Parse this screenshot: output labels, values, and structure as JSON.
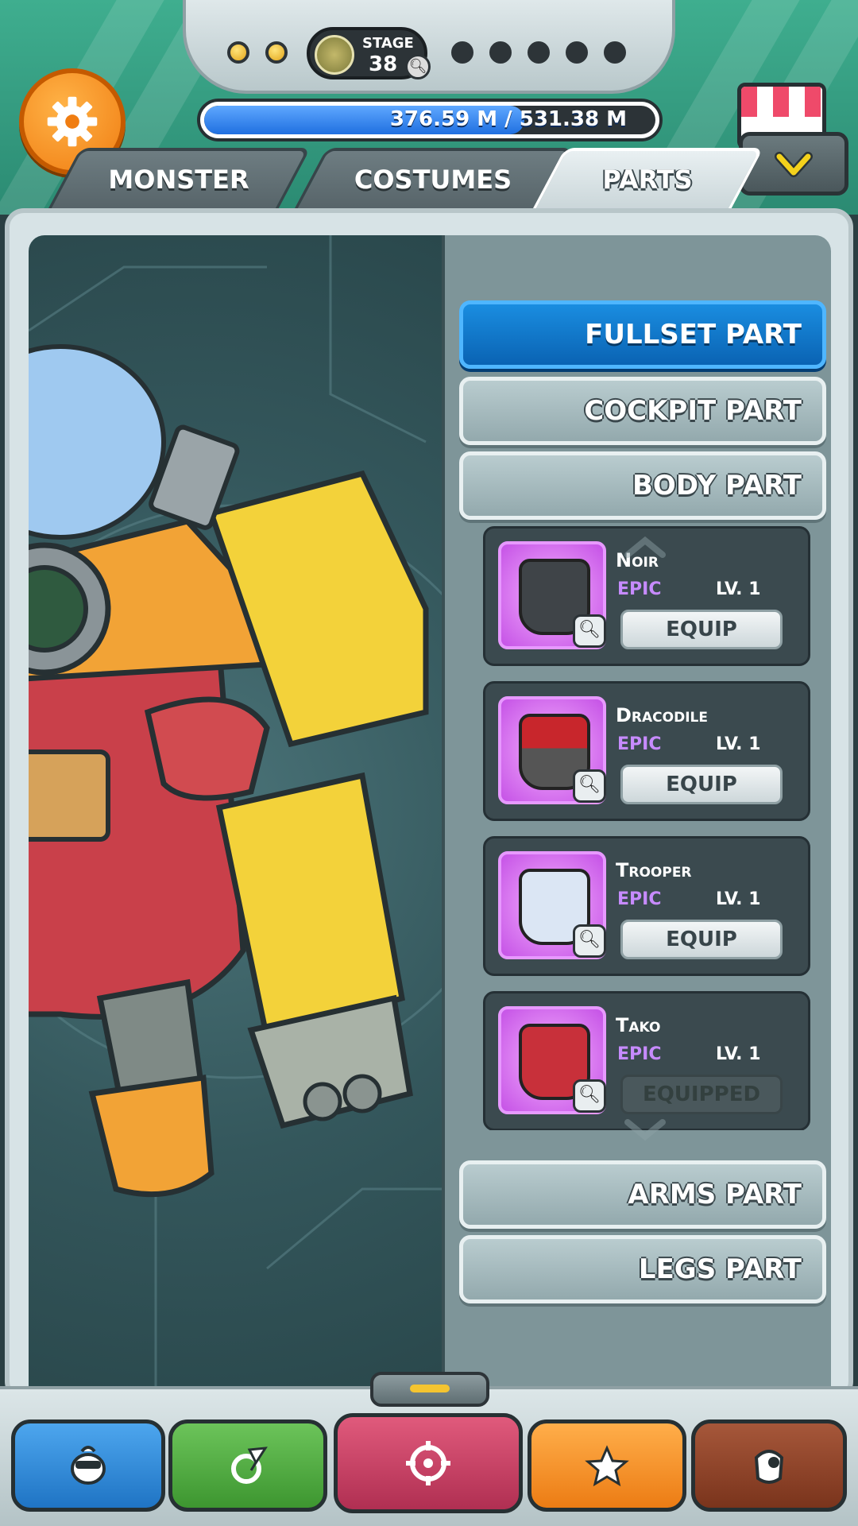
{
  "header": {
    "stage_label": "STAGE",
    "stage_number": "38",
    "progress_dots": {
      "filled": 2,
      "empty": 5
    },
    "hp_current": "376.59 M",
    "hp_max": "531.38 M",
    "hp_separator": "/",
    "hp_fraction": 0.709
  },
  "tabs": [
    {
      "label": "MONSTER",
      "active": false
    },
    {
      "label": "COSTUMES",
      "active": false
    },
    {
      "label": "PARTS",
      "active": true
    }
  ],
  "categories": {
    "fullset": "FULLSET PART",
    "cockpit": "COCKPIT PART",
    "body": "BODY PART",
    "arms": "ARMS PART",
    "legs": "LEGS PART"
  },
  "items": [
    {
      "name": "Noir",
      "rarity": "EPIC",
      "level": "LV. 1",
      "action": "EQUIP",
      "mask_color": "#3f4448",
      "accent": "#e6a020"
    },
    {
      "name": "Dracodile",
      "rarity": "EPIC",
      "level": "LV. 1",
      "action": "EQUIP",
      "mask_color": "#c8262c",
      "accent": "#444"
    },
    {
      "name": "Trooper",
      "rarity": "EPIC",
      "level": "LV. 1",
      "action": "EQUIP",
      "mask_color": "#dbe6f4",
      "accent": "#2c3337"
    },
    {
      "name": "Tako",
      "rarity": "EPIC",
      "level": "LV. 1",
      "action": "EQUIPPED",
      "mask_color": "#c8303a",
      "accent": "#e8c35a"
    }
  ],
  "bottom_nav": [
    {
      "icon": "penguin-icon",
      "color": "#2f8fd8"
    },
    {
      "icon": "slash-icon",
      "color": "#4aa63c"
    },
    {
      "icon": "target-icon",
      "color": "#c43c5e"
    },
    {
      "icon": "star-icon",
      "color": "#f08a1c"
    },
    {
      "icon": "mask-icon",
      "color": "#8a3e22"
    }
  ],
  "colors": {
    "accent_blue": "#0a63b3",
    "epic_purple": "#c78bff",
    "settings_orange": "#f07d12"
  }
}
